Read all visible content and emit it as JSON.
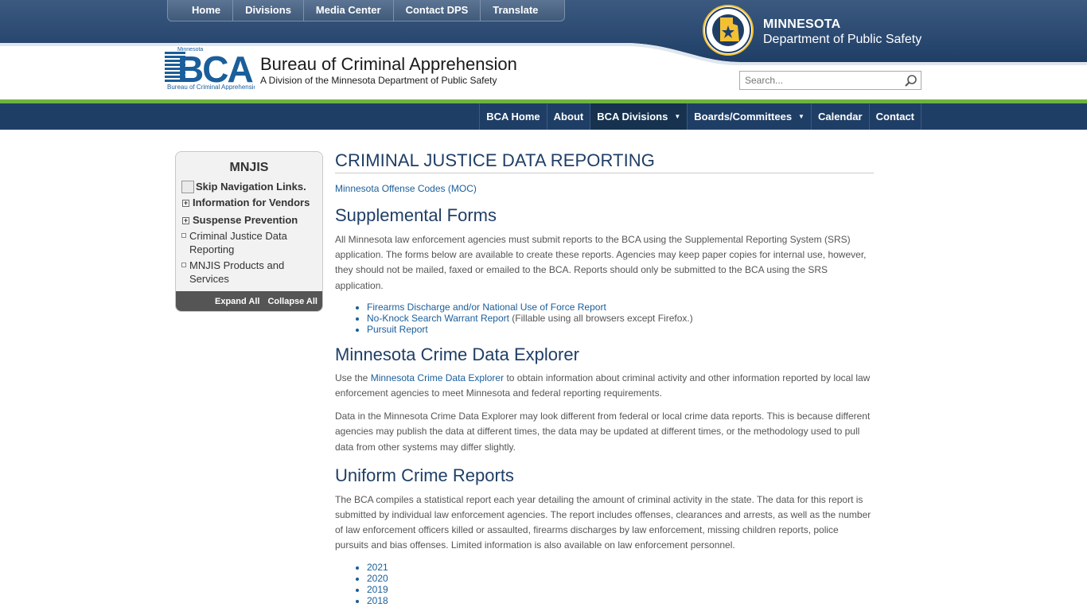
{
  "top_nav": [
    "Home",
    "Divisions",
    "Media Center",
    "Contact DPS",
    "Translate"
  ],
  "dps": {
    "line1": "MINNESOTA",
    "line2": "Department of Public Safety"
  },
  "bca": {
    "logo_small": "Minnesota",
    "logo_big": "BCA",
    "logo_caption": "Bureau of Criminal Apprehension",
    "title": "Bureau of Criminal Apprehension",
    "subtitle": "A Division of the Minnesota Department of Public Safety"
  },
  "search": {
    "placeholder": "Search..."
  },
  "main_nav": [
    {
      "label": "BCA Home"
    },
    {
      "label": "About"
    },
    {
      "label": "BCA Divisions",
      "dropdown": true
    },
    {
      "label": "Boards/Committees",
      "dropdown": true
    },
    {
      "label": "Calendar"
    },
    {
      "label": "Contact"
    }
  ],
  "sidebar": {
    "title": "MNJIS",
    "skip_alt": "Skip Navigation Links.",
    "items": [
      {
        "label": "Information for Vendors",
        "expandable": true
      },
      {
        "label": "Suspense Prevention",
        "expandable": true
      },
      {
        "label": "Criminal Justice Data Reporting",
        "expandable": false
      },
      {
        "label": "MNJIS Products and Services",
        "expandable": false
      }
    ],
    "expand_all": "Expand All",
    "collapse_all": "Collapse All"
  },
  "content": {
    "title": "CRIMINAL JUSTICE DATA REPORTING",
    "moc_link": "Minnesota Offense Codes (MOC)",
    "supplemental": {
      "heading": "Supplemental Forms",
      "para": "All Minnesota law enforcement agencies must submit reports to the BCA using the Supplemental Reporting System (SRS) application. The forms below are available to create these reports. Agencies may keep paper copies for internal use, however, they should not be mailed, faxed or emailed to the BCA. Reports should only be submitted to the BCA using the SRS application.",
      "links": [
        {
          "text": "Firearms Discharge and/or National Use of Force Report",
          "note": ""
        },
        {
          "text": "No-Knock Search Warrant Report",
          "note": " (Fillable using all browsers except Firefox.)"
        },
        {
          "text": "Pursuit Report",
          "note": ""
        }
      ]
    },
    "explorer": {
      "heading": "Minnesota Crime Data Explorer",
      "p1_pre": "Use the ",
      "p1_link": "Minnesota Crime Data Explorer",
      "p1_post": " to obtain information about criminal activity and other information reported by local law enforcement agencies to meet Minnesota and federal reporting requirements.",
      "p2": "Data in the Minnesota Crime Data Explorer may look different from federal or local crime data reports. This is because different agencies may publish the data at different times, the data may be updated at different times, or the methodology used to pull data from other systems may differ slightly."
    },
    "ucr": {
      "heading": "Uniform Crime Reports",
      "para": "The BCA compiles a statistical report each year detailing the amount of criminal activity in the state. The data for this report is submitted by individual law enforcement agencies. The report includes offenses, clearances and arrests, as well as the number of law enforcement officers killed or assaulted, firearms discharges by law enforcement, missing children reports, police pursuits and bias offenses. Limited information is also available on law enforcement personnel.",
      "years": [
        "2021",
        "2020",
        "2019",
        "2018"
      ]
    }
  }
}
